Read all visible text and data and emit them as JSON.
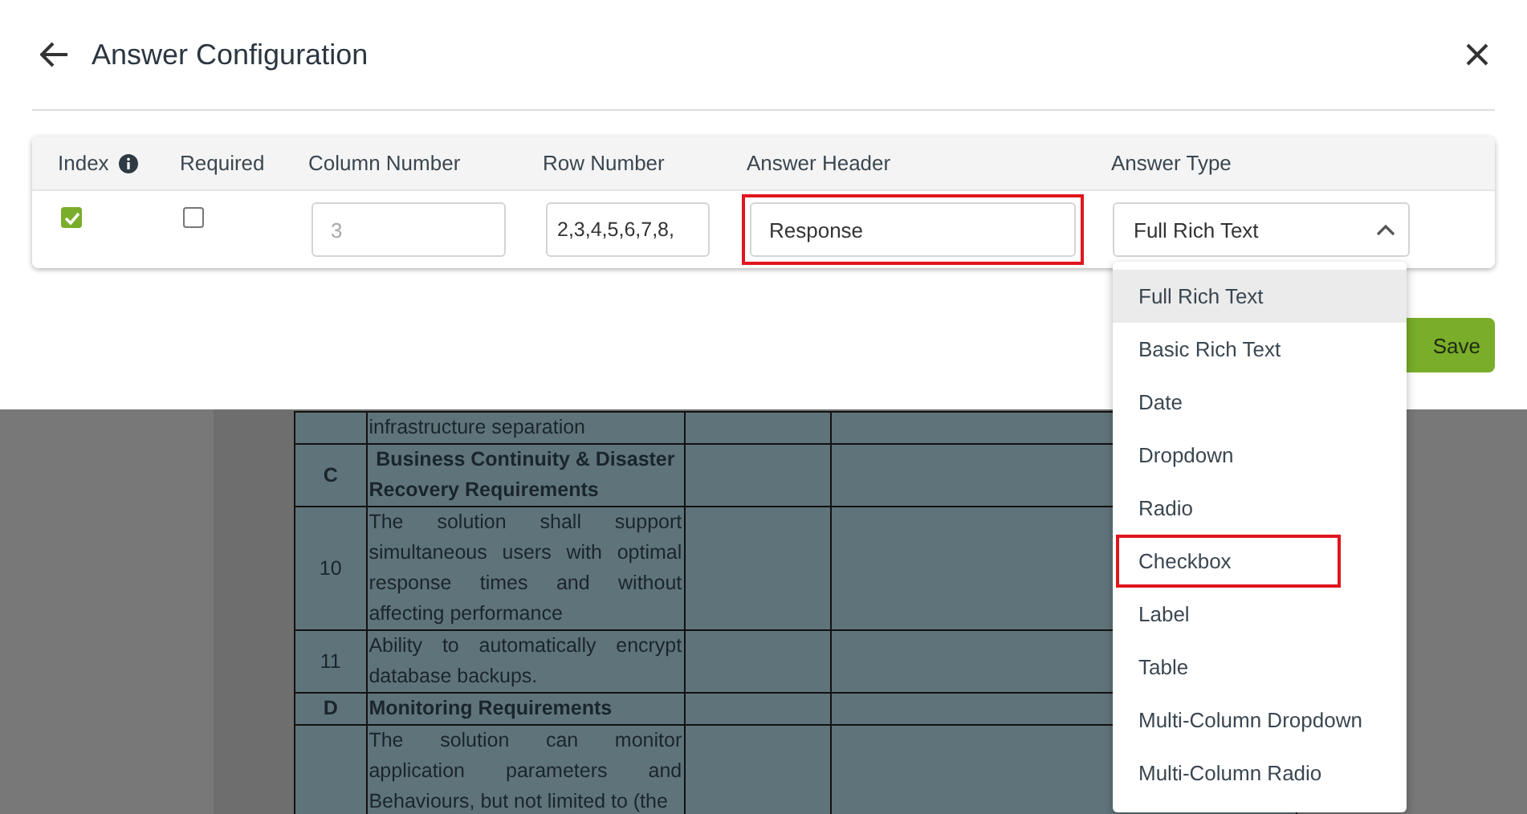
{
  "dialog": {
    "title": "Answer Configuration",
    "columns": [
      {
        "label": "Index",
        "info": true
      },
      {
        "label": "Required",
        "info": false
      },
      {
        "label": "Column Number",
        "info": false
      },
      {
        "label": "Row Number",
        "info": false
      },
      {
        "label": "Answer Header",
        "info": false
      },
      {
        "label": "Answer Type",
        "info": false
      }
    ],
    "row": {
      "index_checked": true,
      "required_checked": false,
      "column_number": {
        "placeholder": "3",
        "highlighted": false
      },
      "row_number": {
        "value": "2,3,4,5,6,7,8,",
        "highlighted": false
      },
      "answer_header": {
        "value": "Response",
        "highlighted": true
      },
      "answer_type": {
        "value": "Full Rich Text",
        "expanded": true
      }
    },
    "save_button": "Save",
    "dropdown_options": [
      {
        "label": "Full Rich Text",
        "selected": true,
        "highlighted": false
      },
      {
        "label": "Basic Rich Text",
        "selected": false,
        "highlighted": false
      },
      {
        "label": "Date",
        "selected": false,
        "highlighted": false
      },
      {
        "label": "Dropdown",
        "selected": false,
        "highlighted": false
      },
      {
        "label": "Radio",
        "selected": false,
        "highlighted": false
      },
      {
        "label": "Checkbox",
        "selected": false,
        "highlighted": true
      },
      {
        "label": "Label",
        "selected": false,
        "highlighted": false
      },
      {
        "label": "Table",
        "selected": false,
        "highlighted": false
      },
      {
        "label": "Multi-Column Dropdown",
        "selected": false,
        "highlighted": false
      },
      {
        "label": "Multi-Column Radio",
        "selected": false,
        "highlighted": false
      }
    ]
  },
  "document_rows": [
    {
      "kind": "item",
      "number": "",
      "text": "infrastructure separation"
    },
    {
      "kind": "section",
      "number": "C",
      "text": "Business Continuity & Disaster Recovery Requirements"
    },
    {
      "kind": "item",
      "number": "10",
      "text": "The solution shall support simultaneous users with optimal response times and without affecting performance"
    },
    {
      "kind": "item",
      "number": "11",
      "text": "Ability to automatically encrypt database backups."
    },
    {
      "kind": "section",
      "number": "D",
      "text": "Monitoring Requirements"
    },
    {
      "kind": "item",
      "number": "",
      "text": "The solution can monitor application parameters and Behaviours, but not limited to (the"
    }
  ]
}
